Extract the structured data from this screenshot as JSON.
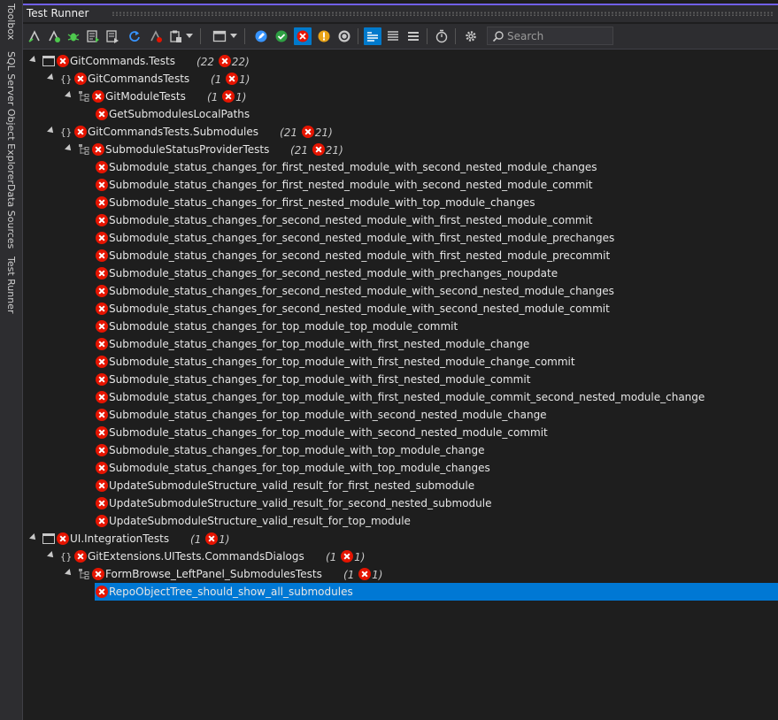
{
  "side_tabs": [
    "Toolbox",
    "SQL Server Object Explorer",
    "Data Sources",
    "Test Runner"
  ],
  "window": {
    "title": "Test Runner"
  },
  "toolbar": {
    "buttons": [
      "run-all-icon",
      "run-selected-icon",
      "debug-icon",
      "run-tests-icon",
      "run-session-icon",
      "refresh-icon",
      "clear-icon",
      "clipboard-icon",
      "layout-icon",
      "highlight-icon",
      "passed-filter-icon",
      "failed-filter-icon",
      "warning-filter-icon",
      "ignored-filter-icon",
      "group-view-icon",
      "list-view-icon",
      "flat-view-icon",
      "timer-icon",
      "settings-icon"
    ],
    "search_placeholder": "Search"
  },
  "colors": {
    "accent": "#007acc",
    "fail": "#e51400",
    "selection": "#0078d4",
    "title_border": "#7160e8"
  },
  "tree": [
    {
      "label": "GitCommands.Tests",
      "kind": "project",
      "total": "22",
      "failed": "22"
    },
    {
      "label": "GitCommandsTests",
      "kind": "namespace",
      "total": "1",
      "failed": "1"
    },
    {
      "label": "GitModuleTests",
      "kind": "class",
      "total": "1",
      "failed": "1"
    },
    {
      "label": "GetSubmodulesLocalPaths",
      "kind": "test"
    },
    {
      "label": "GitCommandsTests.Submodules",
      "kind": "namespace",
      "total": "21",
      "failed": "21"
    },
    {
      "label": "SubmoduleStatusProviderTests",
      "kind": "class",
      "total": "21",
      "failed": "21"
    },
    {
      "label": "Submodule_status_changes_for_first_nested_module_with_second_nested_module_changes",
      "kind": "test"
    },
    {
      "label": "Submodule_status_changes_for_first_nested_module_with_second_nested_module_commit",
      "kind": "test"
    },
    {
      "label": "Submodule_status_changes_for_first_nested_module_with_top_module_changes",
      "kind": "test"
    },
    {
      "label": "Submodule_status_changes_for_second_nested_module_with_first_nested_module_commit",
      "kind": "test"
    },
    {
      "label": "Submodule_status_changes_for_second_nested_module_with_first_nested_module_prechanges",
      "kind": "test"
    },
    {
      "label": "Submodule_status_changes_for_second_nested_module_with_first_nested_module_precommit",
      "kind": "test"
    },
    {
      "label": "Submodule_status_changes_for_second_nested_module_with_prechanges_noupdate",
      "kind": "test"
    },
    {
      "label": "Submodule_status_changes_for_second_nested_module_with_second_nested_module_changes",
      "kind": "test"
    },
    {
      "label": "Submodule_status_changes_for_second_nested_module_with_second_nested_module_commit",
      "kind": "test"
    },
    {
      "label": "Submodule_status_changes_for_top_module_top_module_commit",
      "kind": "test"
    },
    {
      "label": "Submodule_status_changes_for_top_module_with_first_nested_module_change",
      "kind": "test"
    },
    {
      "label": "Submodule_status_changes_for_top_module_with_first_nested_module_change_commit",
      "kind": "test"
    },
    {
      "label": "Submodule_status_changes_for_top_module_with_first_nested_module_commit",
      "kind": "test"
    },
    {
      "label": "Submodule_status_changes_for_top_module_with_first_nested_module_commit_second_nested_module_change",
      "kind": "test"
    },
    {
      "label": "Submodule_status_changes_for_top_module_with_second_nested_module_change",
      "kind": "test"
    },
    {
      "label": "Submodule_status_changes_for_top_module_with_second_nested_module_commit",
      "kind": "test"
    },
    {
      "label": "Submodule_status_changes_for_top_module_with_top_module_change",
      "kind": "test"
    },
    {
      "label": "Submodule_status_changes_for_top_module_with_top_module_changes",
      "kind": "test"
    },
    {
      "label": "UpdateSubmoduleStructure_valid_result_for_first_nested_submodule",
      "kind": "test"
    },
    {
      "label": "UpdateSubmoduleStructure_valid_result_for_second_nested_submodule",
      "kind": "test"
    },
    {
      "label": "UpdateSubmoduleStructure_valid_result_for_top_module",
      "kind": "test"
    },
    {
      "label": "UI.IntegrationTests",
      "kind": "project",
      "total": "1",
      "failed": "1"
    },
    {
      "label": "GitExtensions.UITests.CommandsDialogs",
      "kind": "namespace",
      "total": "1",
      "failed": "1"
    },
    {
      "label": "FormBrowse_LeftPanel_SubmodulesTests",
      "kind": "class",
      "total": "1",
      "failed": "1"
    },
    {
      "label": "RepoObjectTree_should_show_all_submodules",
      "kind": "test",
      "selected": true
    }
  ]
}
